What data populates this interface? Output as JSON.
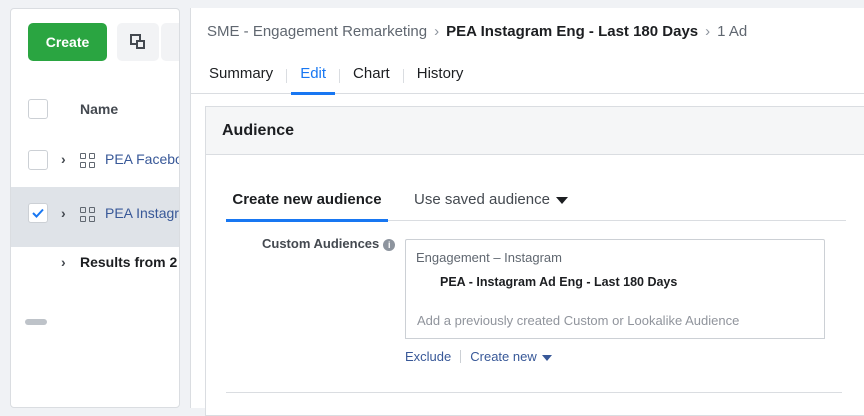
{
  "toolbar": {
    "create_label": "Create"
  },
  "table": {
    "name_header": "Name",
    "rows": [
      {
        "label": "PEA Facebook",
        "selected": false
      },
      {
        "label": "PEA Instagram",
        "selected": true
      }
    ],
    "results_label": "Results from 2"
  },
  "breadcrumb": {
    "campaign": "SME - Engagement Remarketing",
    "adset": "PEA Instagram Eng - Last 180 Days",
    "ads": "1 Ad"
  },
  "tabs": [
    "Summary",
    "Edit",
    "Chart",
    "History"
  ],
  "active_tab": "Edit",
  "audience": {
    "section_title": "Audience",
    "subtab_new": "Create new audience",
    "subtab_saved": "Use saved audience",
    "custom_label": "Custom Audiences",
    "category": "Engagement – Instagram",
    "selected_item": "PEA - Instagram Ad Eng - Last 180 Days",
    "input_placeholder": "Add a previously created Custom or Lookalike Audience",
    "exclude_label": "Exclude",
    "create_new_label": "Create new"
  },
  "colors": {
    "create_button": "#2aa541",
    "accent": "#1877f2",
    "link": "#385898"
  }
}
